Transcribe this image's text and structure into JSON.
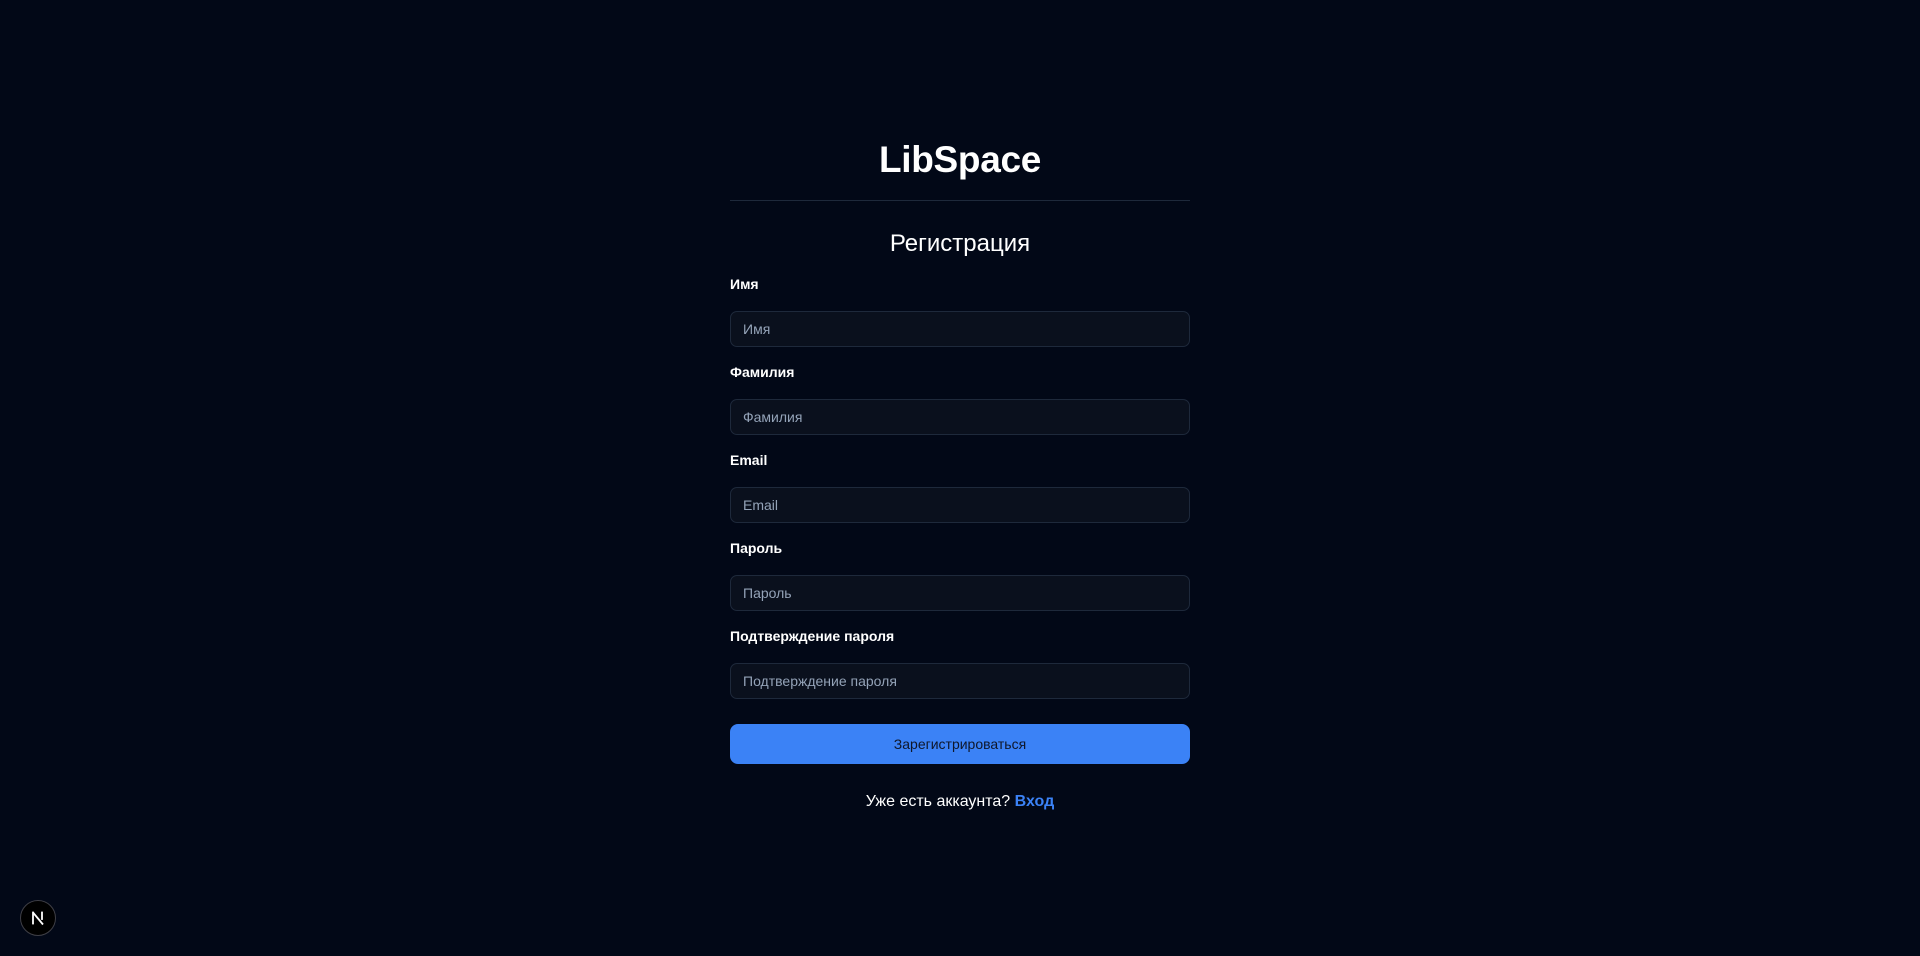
{
  "brand": {
    "name": "LibSpace"
  },
  "form": {
    "title": "Регистрация",
    "fields": [
      {
        "label": "Имя",
        "placeholder": "Имя"
      },
      {
        "label": "Фамилия",
        "placeholder": "Фамилия"
      },
      {
        "label": "Email",
        "placeholder": "Email"
      },
      {
        "label": "Пароль",
        "placeholder": "Пароль"
      },
      {
        "label": "Подтверждение пароля",
        "placeholder": "Подтверждение пароля"
      }
    ],
    "submit_label": "Зарегистрироваться"
  },
  "login_prompt": {
    "text": "Уже есть аккаунта?",
    "link_label": "Вход"
  },
  "dev_badge": {
    "icon": "nextjs-logo-icon"
  },
  "colors": {
    "background": "#020817",
    "accent": "#3b82f6",
    "input_background": "#0a101d",
    "border": "#1e293b"
  }
}
